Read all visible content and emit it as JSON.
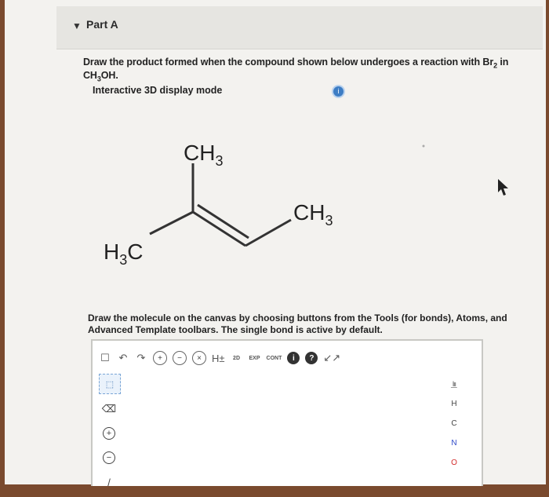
{
  "part": {
    "caret_icon": "triangle-down-icon",
    "title": "Part A"
  },
  "question": {
    "text_pre": "Draw the product formed when the compound shown below undergoes a reaction with Br",
    "br_sub": "2",
    "text_mid": " in CH",
    "ch_sub": "3",
    "text_post": "OH."
  },
  "display_mode": {
    "label": "Interactive 3D display mode",
    "info_icon": "info-icon"
  },
  "molecule": {
    "label_top": "CH",
    "label_top_sub": "3",
    "label_right": "CH",
    "label_right_sub": "3",
    "label_left": "H",
    "label_left_sub": "3",
    "label_left_tail": "C"
  },
  "instructions": "Draw the molecule on the canvas by choosing buttons from the Tools (for bonds), Atoms, and Advanced Template toolbars. The single bond is active by default.",
  "toolbar": {
    "new_icon": "☐",
    "undo_icon": "↶",
    "redo_icon": "↷",
    "zoom_in": "+",
    "zoom_out": "−",
    "clear": "×",
    "h_toggle": "H±",
    "twod": "2D",
    "exp": "EXP",
    "cont": "CONT",
    "info": "i",
    "help": "?",
    "expand_icon": "↙↗"
  },
  "left_tools": {
    "select": "⬚",
    "eraser": "⌫",
    "charge_plus": "+",
    "charge_minus": "−",
    "bond": "/"
  },
  "atoms": {
    "periodic": "l͟ıı",
    "items": [
      "H",
      "C",
      "N",
      "O"
    ]
  }
}
